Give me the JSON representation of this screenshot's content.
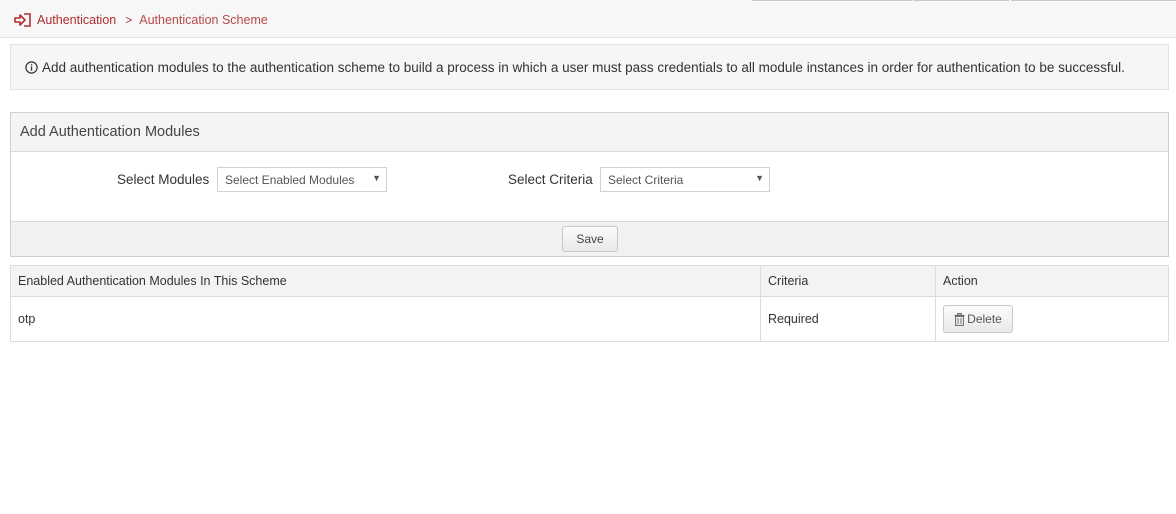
{
  "breadcrumb": {
    "icon": "sign-in-icon",
    "root": "Authentication",
    "separator": ">",
    "current": "Authentication Scheme"
  },
  "info_banner": {
    "icon": "info-circle-icon",
    "text": "Add authentication modules to the authentication scheme to build a process in which a user must pass credentials to all module instances in order for authentication to be successful."
  },
  "panel": {
    "title": "Add Authentication Modules",
    "modules_label": "Select Modules",
    "modules_placeholder": "Select Enabled Modules",
    "criteria_label": "Select Criteria",
    "criteria_placeholder": "Select Criteria",
    "save_label": "Save"
  },
  "table": {
    "headers": [
      "Enabled Authentication Modules In This Scheme",
      "Criteria",
      "Action"
    ],
    "rows": [
      {
        "module": "otp",
        "criteria": "Required",
        "action_label": "Delete",
        "action_icon": "trash-icon"
      }
    ]
  },
  "colors": {
    "accent": "#b32d2e",
    "banner_bg": "#f6f6f6",
    "header_bg": "#f4f4f4"
  }
}
